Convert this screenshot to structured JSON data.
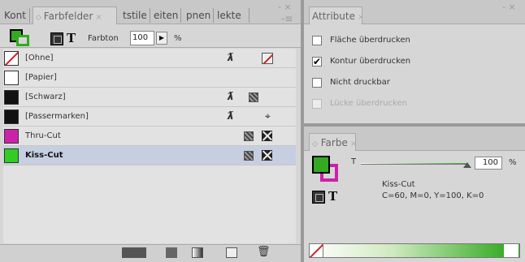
{
  "swatches_panel": {
    "tabs": [
      {
        "label": "Kont"
      },
      {
        "label": "Farbfelder",
        "close": "×"
      },
      {
        "label": "tstile"
      },
      {
        "label": "eiten"
      },
      {
        "label": "pnen"
      },
      {
        "label": "lekte"
      }
    ],
    "tint_label": "Farbton",
    "tint_value": "100",
    "tint_arrow": "▶",
    "tint_unit": "%",
    "swatches": [
      {
        "name": "[Ohne]",
        "color": "#ffffff"
      },
      {
        "name": "[Papier]",
        "color": "#ffffff"
      },
      {
        "name": "[Schwarz]",
        "color": "#111111"
      },
      {
        "name": "[Passermarken]",
        "color": "#111111"
      },
      {
        "name": "Thru-Cut",
        "color": "#cc22aa"
      },
      {
        "name": "Kiss-Cut",
        "color": "#33cc22",
        "selected": true
      }
    ],
    "lock_icon_glyph": "ƛ",
    "registration_glyph": "⌖"
  },
  "attributes_panel": {
    "tab": "Attribute",
    "close": "×",
    "options": [
      {
        "label": "Fläche überdrucken",
        "checked": false,
        "disabled": false
      },
      {
        "label": "Kontur überdrucken",
        "checked": true,
        "disabled": false
      },
      {
        "label": "Nicht druckbar",
        "checked": false,
        "disabled": false
      },
      {
        "label": "Lücke überdrucken",
        "checked": false,
        "disabled": true
      }
    ],
    "check_glyph": "✔"
  },
  "color_panel": {
    "tab": "Farbe",
    "tab_marker": "◇",
    "close": "×",
    "t_label": "T",
    "t_value": "100",
    "t_unit": "%",
    "swatch_name": "Kiss-Cut",
    "swatch_values": "C=60, M=0, Y=100, K=0",
    "fill_color": "#33aa22",
    "stroke_color": "#cc22aa"
  },
  "common": {
    "format_t": "T",
    "panel_close": "×",
    "panel_menu": "-≡",
    "panel_min": "- ×"
  }
}
